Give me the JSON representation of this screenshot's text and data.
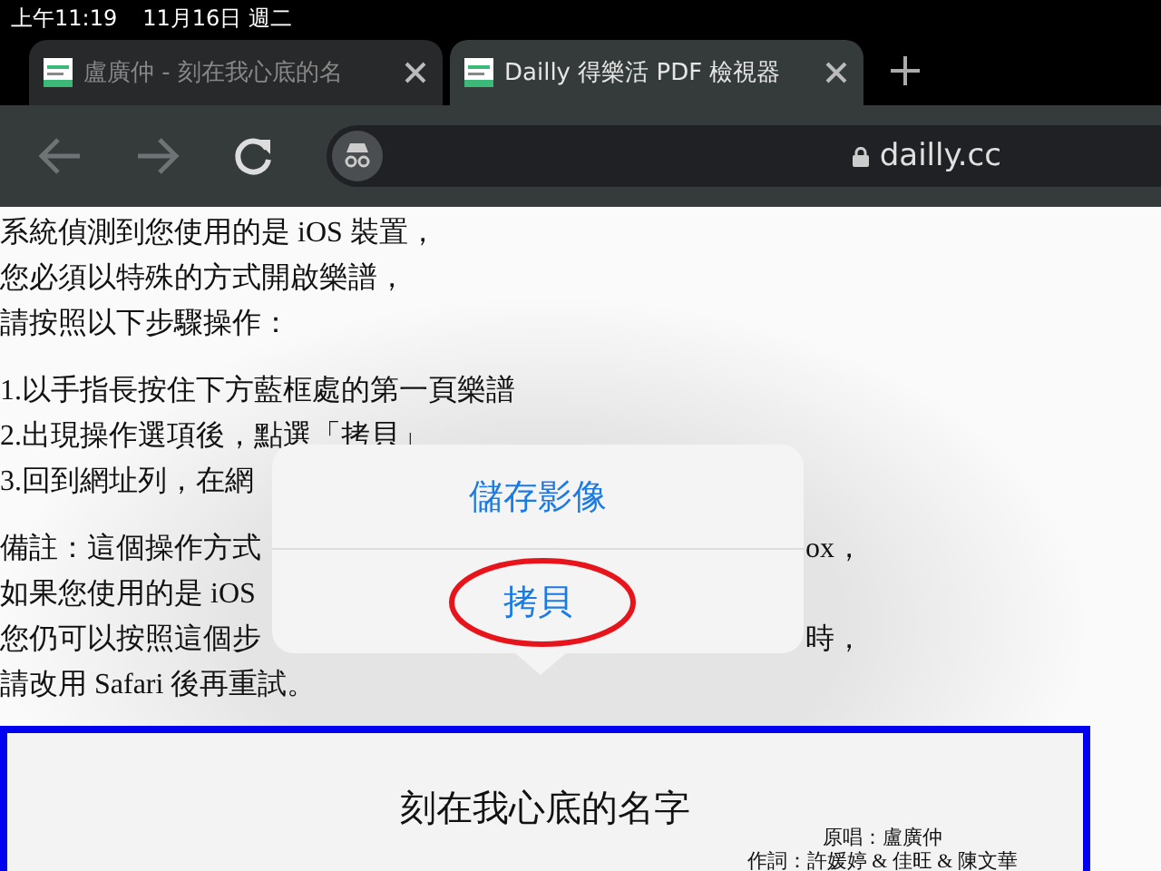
{
  "status_bar": {
    "time": "上午11:19",
    "date": "11月16日 週二"
  },
  "tabs": [
    {
      "title": "盧廣仲 - 刻在我心底的名",
      "selected": false
    },
    {
      "title": "Dailly 得樂活 PDF 檢視器",
      "selected": true
    }
  ],
  "address_bar": {
    "url": "dailly.cc"
  },
  "paragraphs": [
    [
      {
        "text": "系統偵測到您使用的是 iOS 裝置，"
      },
      {
        "text": "您必須以特殊的方式開啟樂譜，"
      },
      {
        "text": "請按照以下步驟操作："
      }
    ],
    [
      {
        "text": "1.以手指長按住下方藍框處的第一頁樂譜"
      },
      {
        "text": "2.出現操作選項後，點選「拷貝」"
      },
      {
        "text": "3.回到網址列，在網"
      }
    ],
    [
      {
        "text": "備註：這個操作方式",
        "tail": "ox，"
      },
      {
        "text": "如果您使用的是 iOS"
      },
      {
        "text": "您仍可以按照這個步",
        "tail": "時，"
      },
      {
        "text": "請改用 Safari 後再重試。"
      }
    ]
  ],
  "popup_menu": [
    {
      "label": "儲存影像",
      "circled": false
    },
    {
      "label": "拷貝",
      "circled": true
    }
  ],
  "sheet": {
    "title": "刻在我心底的名字",
    "credits": [
      "原唱：盧廣仲",
      "作詞：許媛婷 & 佳旺 & 陳文華"
    ]
  }
}
